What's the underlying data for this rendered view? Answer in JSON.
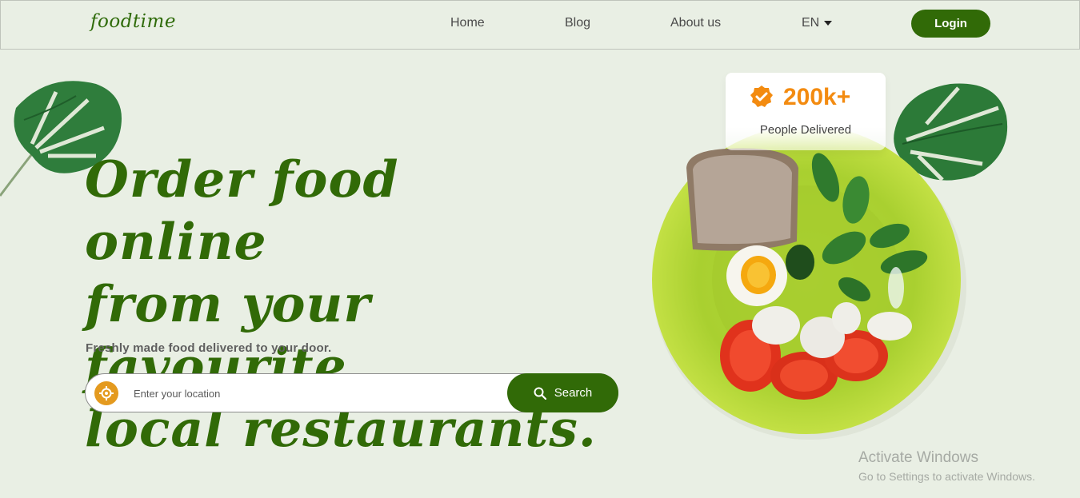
{
  "brand": {
    "logo": "foodtime"
  },
  "nav": {
    "items": [
      {
        "label": "Home"
      },
      {
        "label": "Blog"
      },
      {
        "label": "About us"
      }
    ],
    "language": "EN",
    "login_label": "Login"
  },
  "hero": {
    "headline_lines": [
      "Order food online",
      "from your favourite",
      "local restaurants."
    ],
    "subtitle": "Freshly made food delivered to your door.",
    "search": {
      "placeholder": "Enter your location",
      "button_label": "Search"
    }
  },
  "badge": {
    "count": "200k+",
    "label": "People Delivered"
  },
  "watermark": {
    "title": "Activate Windows",
    "subtitle": "Go to Settings to activate Windows."
  },
  "colors": {
    "brand_green": "#316a07",
    "accent_orange": "#f38b10",
    "location_icon": "#e49a1f",
    "background": "#e9efe4"
  }
}
